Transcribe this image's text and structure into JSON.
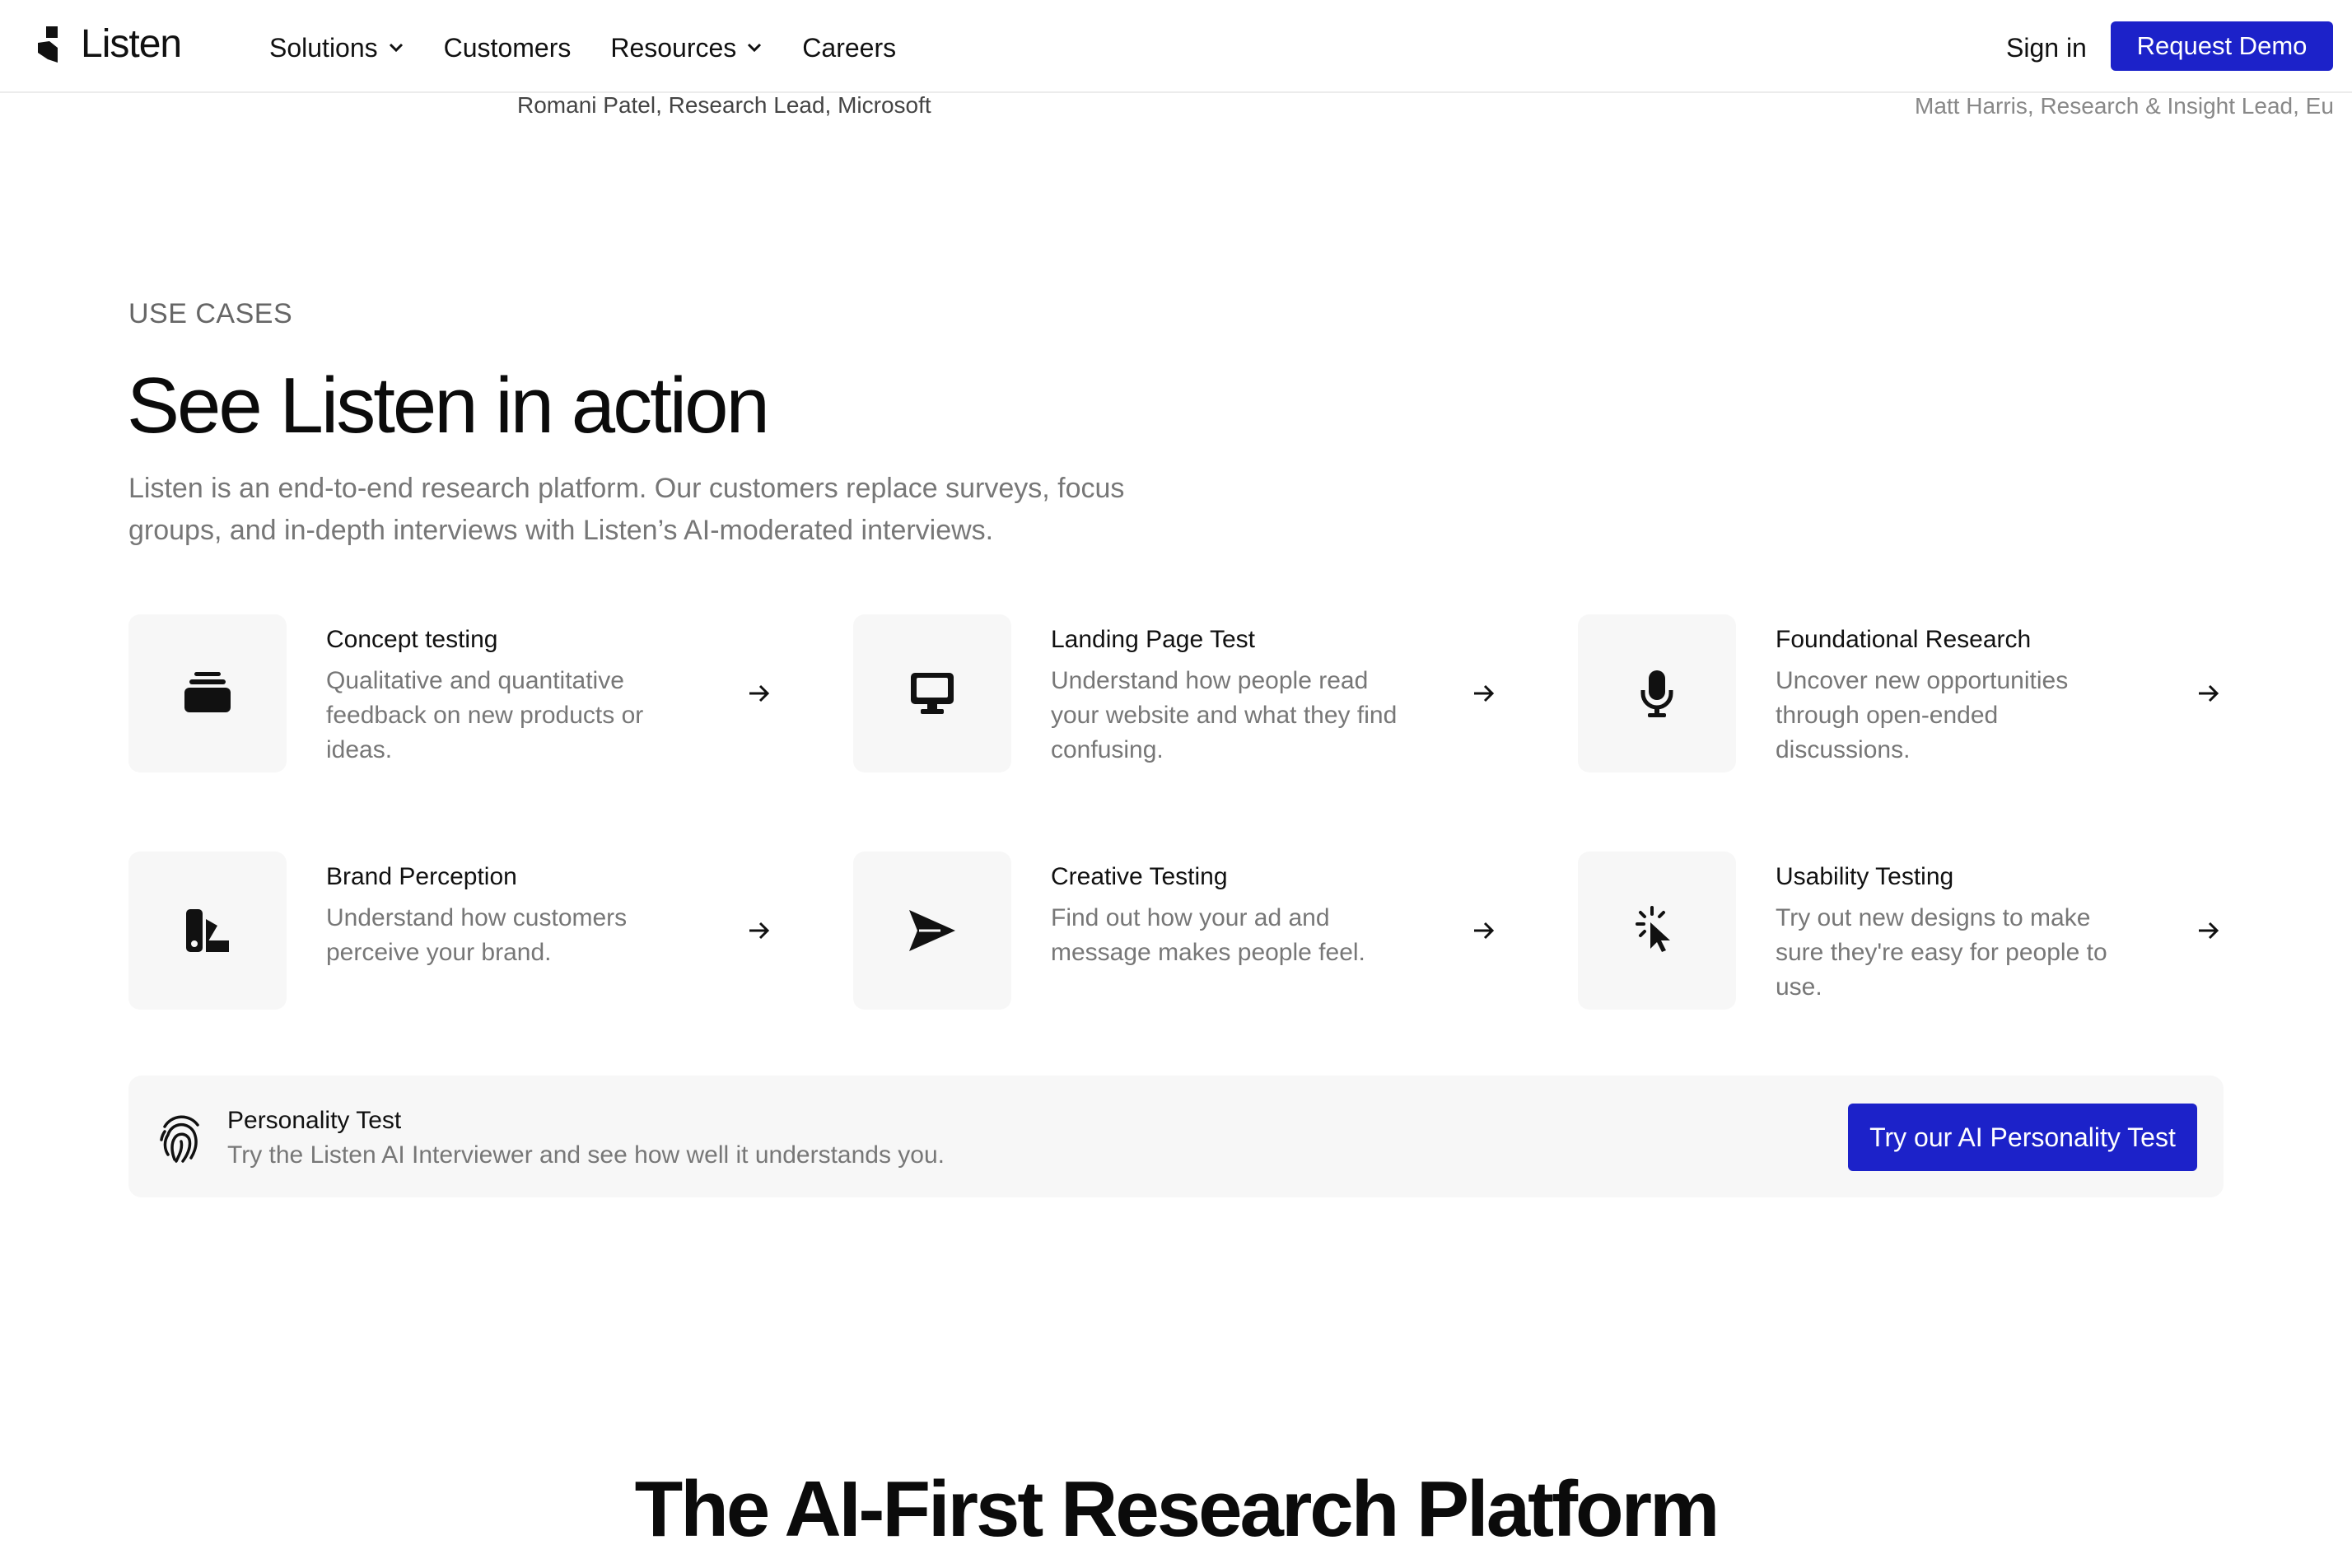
{
  "header": {
    "brand": "Listen",
    "nav": [
      {
        "label": "Solutions",
        "dropdown": true
      },
      {
        "label": "Customers",
        "dropdown": false
      },
      {
        "label": "Resources",
        "dropdown": true
      },
      {
        "label": "Careers",
        "dropdown": false
      }
    ],
    "signin_label": "Sign in",
    "demo_label": "Request Demo"
  },
  "testimonials": {
    "left_attribution": "Romani Patel, Research Lead, Microsoft",
    "right_attribution": "Matt Harris, Research & Insight Lead, Eu"
  },
  "use_cases": {
    "eyebrow": "USE CASES",
    "title": "See Listen in action",
    "subtitle": "Listen is an end-to-end research platform. Our customers replace surveys, focus groups, and in-depth interviews with Listen’s AI-moderated interviews.",
    "cards": [
      {
        "title": "Concept testing",
        "desc": "Qualitative  and quantitative feedback on new products or ideas.",
        "icon": "concept-stack-icon"
      },
      {
        "title": "Landing Page Test",
        "desc": "Understand how people read your website and what they find confusing.",
        "icon": "monitor-icon"
      },
      {
        "title": "Foundational Research",
        "desc": "Uncover new opportunities through open-ended discussions.",
        "icon": "microphone-icon"
      },
      {
        "title": "Brand Perception",
        "desc": "Understand how customers perceive your brand.",
        "icon": "swatches-icon"
      },
      {
        "title": "Creative Testing",
        "desc": "Find out how your ad and message makes people feel.",
        "icon": "send-icon"
      },
      {
        "title": "Usability Testing",
        "desc": "Try out new designs to make sure they're easy for people to use.",
        "icon": "cursor-click-icon"
      }
    ]
  },
  "personality": {
    "title": "Personality Test",
    "desc": "Try the Listen AI Interviewer and see how well it understands you.",
    "button_label": "Try our AI Personality Test",
    "icon": "fingerprint-icon"
  },
  "platform": {
    "title": "The AI-First Research Platform"
  },
  "colors": {
    "accent": "#1c22c9",
    "tile_bg": "#f7f7f7",
    "muted_text": "#777777"
  }
}
